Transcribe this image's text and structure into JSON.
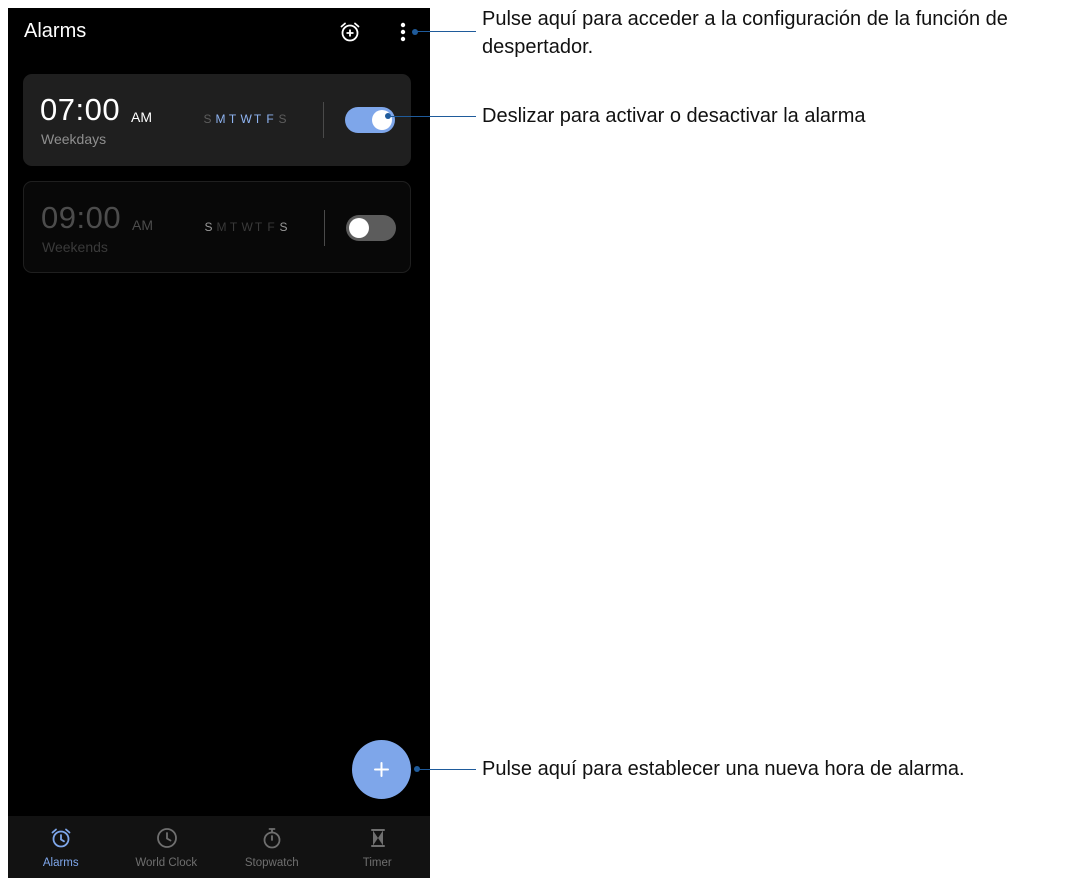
{
  "header": {
    "title": "Alarms"
  },
  "alarms": [
    {
      "time": "07:00",
      "ampm": "AM",
      "label": "Weekdays",
      "enabled": true,
      "days": [
        "S",
        "M",
        "T",
        "W",
        "T",
        "F",
        "S"
      ],
      "active_days": [
        false,
        true,
        true,
        true,
        true,
        true,
        false
      ]
    },
    {
      "time": "09:00",
      "ampm": "AM",
      "label": "Weekends",
      "enabled": false,
      "days": [
        "S",
        "M",
        "T",
        "W",
        "T",
        "F",
        "S"
      ],
      "active_days": [
        true,
        false,
        false,
        false,
        false,
        false,
        true
      ]
    }
  ],
  "nav": [
    {
      "label": "Alarms",
      "icon": "alarm-clock-icon",
      "active": true
    },
    {
      "label": "World Clock",
      "icon": "clock-icon",
      "active": false
    },
    {
      "label": "Stopwatch",
      "icon": "stopwatch-icon",
      "active": false
    },
    {
      "label": "Timer",
      "icon": "hourglass-icon",
      "active": false
    }
  ],
  "callouts": {
    "settings": "Pulse aquí para acceder a la configuración de la función de despertador.",
    "toggle": "Deslizar para activar o desactivar la alarma",
    "add": "Pulse aquí para establecer una nueva hora de alarma."
  },
  "colors": {
    "accent": "#7ea6ea",
    "callout_line": "#1f5b9b",
    "screen_bg": "#000000",
    "card_bg": "#1f1f1f",
    "day_active_on": "#8fb4f2",
    "day_inactive_on": "#5d5d5d",
    "day_active_off": "#9a9a9a",
    "day_inactive_off": "#3a3a3a"
  }
}
